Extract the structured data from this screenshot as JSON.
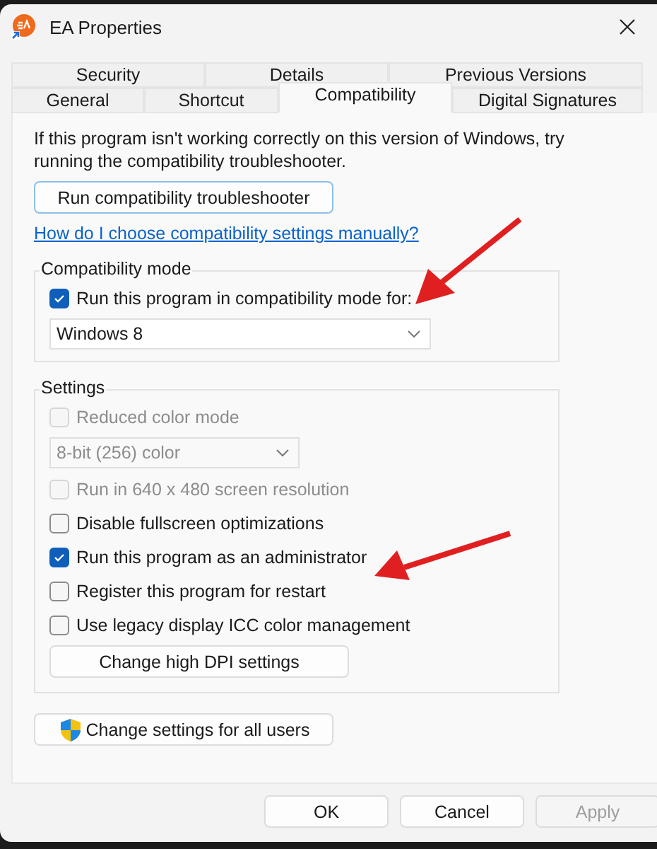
{
  "window": {
    "title": "EA Properties"
  },
  "tab_rows": [
    {
      "tabs": [
        {
          "label": "Security",
          "selected": false
        },
        {
          "label": "Details",
          "selected": false
        },
        {
          "label": "Previous Versions",
          "selected": false
        }
      ]
    },
    {
      "tabs": [
        {
          "label": "General",
          "selected": false
        },
        {
          "label": "Shortcut",
          "selected": false
        },
        {
          "label": "Compatibility",
          "selected": true
        },
        {
          "label": "Digital Signatures",
          "selected": false
        }
      ]
    }
  ],
  "intro": "If this program isn't working correctly on this version of Windows, try running the compatibility troubleshooter.",
  "troubleshooter_button": "Run compatibility troubleshooter",
  "help_link": "How do I choose compatibility settings manually?",
  "compatibility_mode": {
    "title": "Compatibility mode",
    "checkbox": {
      "label": "Run this program in compatibility mode for:",
      "checked": true
    },
    "dropdown": {
      "value": "Windows 8",
      "disabled": false
    }
  },
  "settings": {
    "title": "Settings",
    "items": [
      {
        "kind": "checkbox",
        "label": "Reduced color mode",
        "checked": false,
        "disabled": true
      },
      {
        "kind": "dropdown",
        "value": "8-bit (256) color",
        "disabled": true
      },
      {
        "kind": "checkbox",
        "label": "Run in 640 x 480 screen resolution",
        "checked": false,
        "disabled": true
      },
      {
        "kind": "checkbox",
        "label": "Disable fullscreen optimizations",
        "checked": false,
        "disabled": false
      },
      {
        "kind": "checkbox",
        "label": "Run this program as an administrator",
        "checked": true,
        "disabled": false
      },
      {
        "kind": "checkbox",
        "label": "Register this program for restart",
        "checked": false,
        "disabled": false
      },
      {
        "kind": "checkbox",
        "label": "Use legacy display ICC color management",
        "checked": false,
        "disabled": false
      },
      {
        "kind": "button",
        "label": "Change high DPI settings",
        "disabled": false
      }
    ]
  },
  "all_users_button": "Change settings for all users",
  "buttons": [
    {
      "label": "OK",
      "disabled": false
    },
    {
      "label": "Cancel",
      "disabled": false
    },
    {
      "label": "Apply",
      "disabled": true
    }
  ]
}
